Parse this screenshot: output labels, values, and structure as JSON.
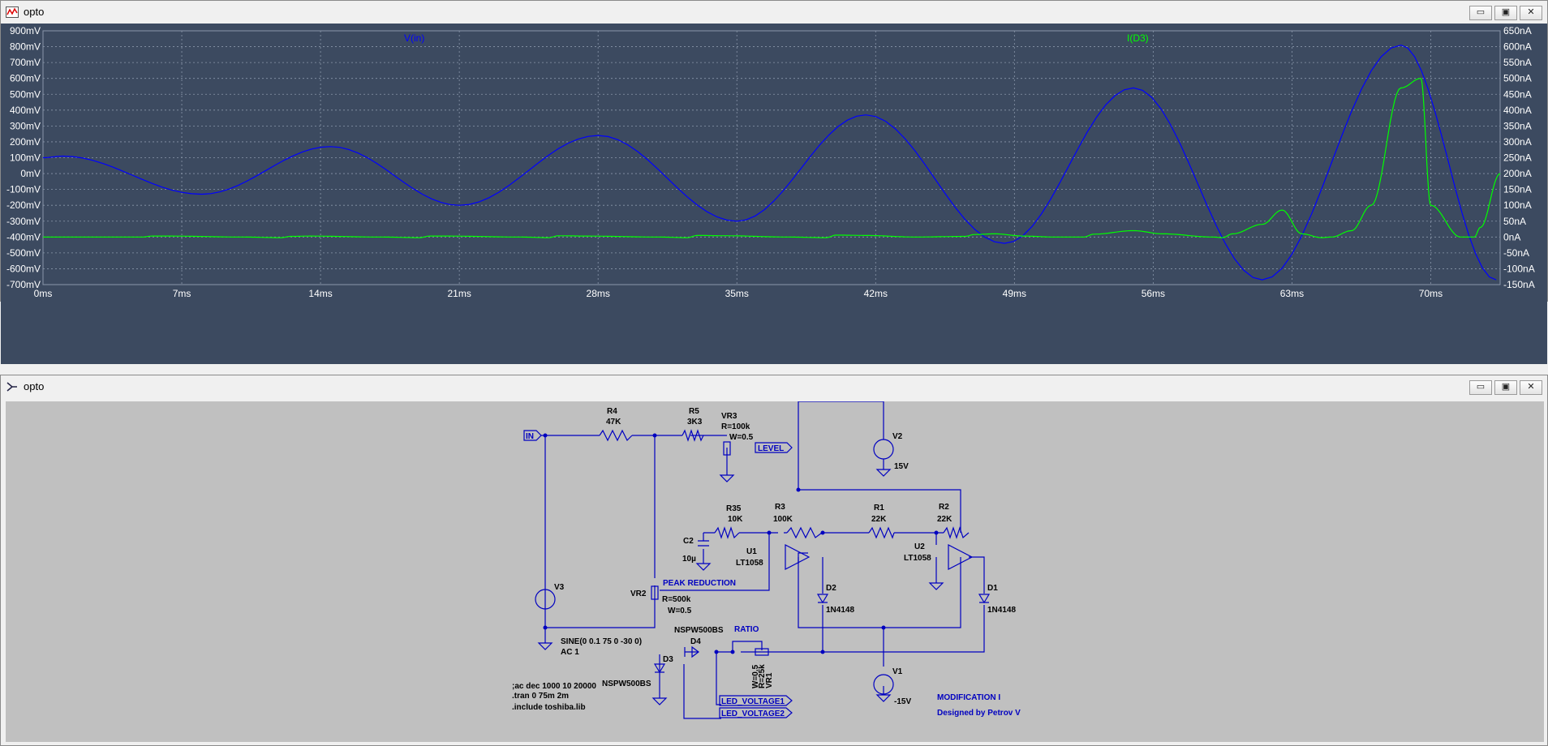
{
  "plot_window": {
    "title": "opto",
    "icon": "waveform-icon",
    "buttons": {
      "minimize": "▭",
      "restore": "▣",
      "close": "✕"
    }
  },
  "chart_data": {
    "type": "line",
    "background": "#3c4a60",
    "grid": true,
    "x_label": "",
    "x_ticks": [
      "0ms",
      "7ms",
      "14ms",
      "21ms",
      "28ms",
      "35ms",
      "42ms",
      "49ms",
      "56ms",
      "63ms",
      "70ms"
    ],
    "xlim": [
      0,
      73.5
    ],
    "left_axis": {
      "ticks": [
        "900mV",
        "800mV",
        "700mV",
        "600mV",
        "500mV",
        "400mV",
        "300mV",
        "200mV",
        "100mV",
        "0mV",
        "-100mV",
        "-200mV",
        "-300mV",
        "-400mV",
        "-500mV",
        "-600mV",
        "-700mV"
      ],
      "ylim": [
        -700,
        900
      ],
      "unit": "mV"
    },
    "right_axis": {
      "ticks": [
        "650nA",
        "600nA",
        "550nA",
        "500nA",
        "450nA",
        "400nA",
        "350nA",
        "300nA",
        "250nA",
        "200nA",
        "150nA",
        "100nA",
        "50nA",
        "0nA",
        "-50nA",
        "-100nA",
        "-150nA"
      ],
      "ylim": [
        -150,
        650
      ],
      "unit": "nA"
    },
    "series": [
      {
        "name": "V(in)",
        "color": "#0000ff",
        "axis": "left",
        "x": [
          0,
          1,
          8,
          14.5,
          21,
          28,
          35,
          41.5,
          48.5,
          55,
          61.5,
          68.5,
          73.3
        ],
        "y": [
          100,
          110,
          -130,
          170,
          -200,
          240,
          -300,
          370,
          -440,
          540,
          -670,
          810,
          -670
        ]
      },
      {
        "name": "I(D3)",
        "color": "#00ff00",
        "axis": "right",
        "x": [
          0,
          5,
          5.5,
          6.5,
          10,
          12,
          12.5,
          13.5,
          17,
          19,
          19.5,
          20.5,
          24,
          25.5,
          26,
          27.5,
          31,
          32.5,
          33,
          34.5,
          37.5,
          39.5,
          40,
          41.5,
          44,
          46.5,
          47,
          48,
          49.5,
          51,
          52.5,
          53,
          55,
          56.5,
          59,
          59.5,
          60,
          61.5,
          62.5,
          63.5,
          64.5,
          65,
          66,
          67,
          68.5,
          69.5,
          70,
          71.5,
          72.2,
          72.5,
          73.5
        ],
        "y": [
          0,
          0,
          3,
          3,
          0,
          -2,
          2,
          3,
          0,
          -2,
          3,
          3,
          0,
          -2,
          4,
          3,
          0,
          -2,
          5,
          4,
          0,
          -2,
          6,
          5,
          0,
          2,
          8,
          10,
          3,
          0,
          0,
          9,
          20,
          10,
          0,
          -2,
          10,
          40,
          85,
          10,
          -2,
          0,
          20,
          100,
          470,
          500,
          100,
          0,
          0,
          30,
          200
        ]
      }
    ]
  },
  "schematic_window": {
    "title": "opto",
    "icon": "schematic-icon",
    "buttons": {
      "minimize": "▭",
      "restore": "▣",
      "close": "✕"
    }
  },
  "schematic": {
    "wire_color": "#0000c0",
    "components": {
      "r4": {
        "name": "R4",
        "value": "47K"
      },
      "r5": {
        "name": "R5",
        "value": "3K3"
      },
      "vr3": {
        "name": "VR3",
        "r": "R=100k",
        "w": "W=0.5"
      },
      "v2": {
        "name": "V2",
        "value": "15V"
      },
      "r35": {
        "name": "R35",
        "value": "10K"
      },
      "r3": {
        "name": "R3",
        "value": "100K"
      },
      "r1": {
        "name": "R1",
        "value": "22K"
      },
      "r2": {
        "name": "R2",
        "value": "22K"
      },
      "c2": {
        "name": "C2",
        "value": "10µ"
      },
      "u1": {
        "name": "U1",
        "value": "LT1058"
      },
      "u2": {
        "name": "U2",
        "value": "LT1058"
      },
      "d2": {
        "name": "D2",
        "value": "1N4148"
      },
      "d1": {
        "name": "D1",
        "value": "1N4148"
      },
      "v3": {
        "name": "V3",
        "value": "SINE(0 0.1 75 0 -30 0)",
        "ac": "AC 1"
      },
      "vr2": {
        "name": "VR2",
        "r": "R=500k",
        "w": "W=0.5"
      },
      "d4": {
        "name": "D4",
        "value": "NSPW500BS"
      },
      "d3": {
        "name": "D3",
        "value": "NSPW500BS"
      },
      "vr1": {
        "name": "VR1",
        "r": "R=25k",
        "w": "W=0.5"
      },
      "v1": {
        "name": "V1",
        "value": "-15V"
      }
    },
    "labels": {
      "in": "IN",
      "level": "LEVEL",
      "peak_reduction": "PEAK REDUCTION",
      "ratio": "RATIO",
      "led_voltage1": "LED_VOLTAGE1",
      "led_voltage2": "LED_VOLTAGE2"
    },
    "directives": [
      ";ac dec 1000 10 20000",
      ".tran 0 75m 2m",
      ".include toshiba.lib"
    ],
    "notes": {
      "modification": "MODIFICATION I",
      "designer": "Designed by Petrov V"
    }
  }
}
